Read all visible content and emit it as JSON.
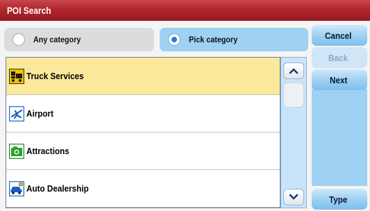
{
  "title": "POI Search",
  "category": {
    "any_label": "Any category",
    "pick_label": "Pick category",
    "selected": "pick"
  },
  "list": {
    "items": [
      {
        "label": "Truck Services",
        "icon": "truck-services-icon",
        "selected": true
      },
      {
        "label": "Airport",
        "icon": "airplane-icon",
        "selected": false
      },
      {
        "label": "Attractions",
        "icon": "camera-icon",
        "selected": false
      },
      {
        "label": "Auto Dealership",
        "icon": "car-dealer-icon",
        "selected": false
      }
    ]
  },
  "buttons": {
    "cancel": "Cancel",
    "back": "Back",
    "next": "Next",
    "type": "Type"
  },
  "colors": {
    "title_bar": "#b0262c",
    "selected_row": "#fbe89a",
    "accent_blue": "#9fd1f3"
  }
}
